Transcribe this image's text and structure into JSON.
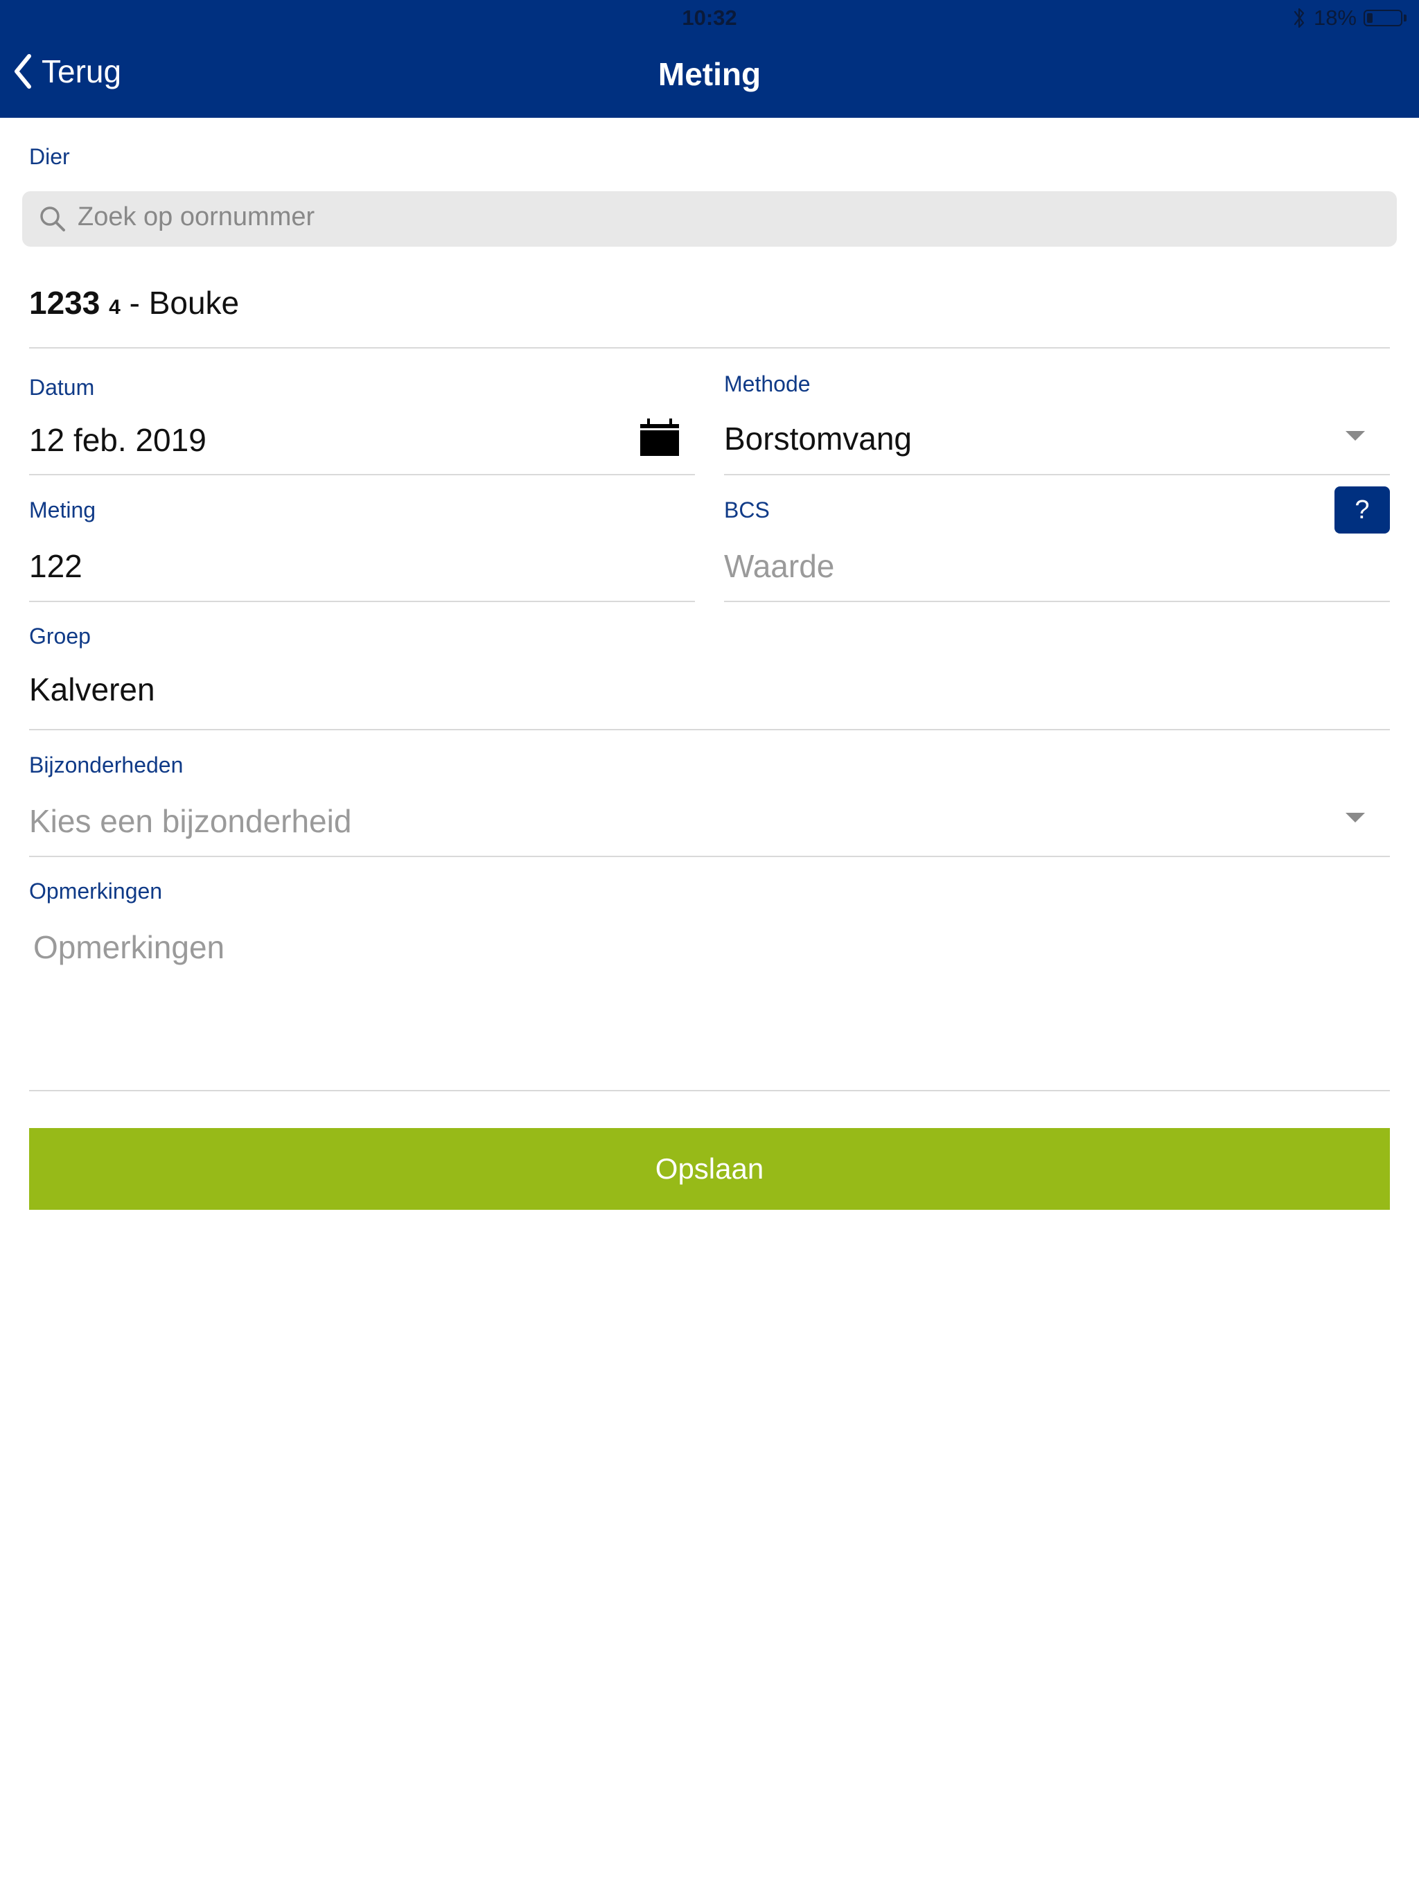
{
  "status_bar": {
    "time": "10:32",
    "battery_percent": "18%",
    "battery_level": 0.18,
    "icons": [
      "bluetooth-icon",
      "battery-icon"
    ]
  },
  "nav": {
    "back_label": "Terug",
    "title": "Meting",
    "back_icon": "chevron-left-icon"
  },
  "colors": {
    "header": "#003080",
    "label": "#0f3a87",
    "save_button": "#97ba18",
    "help_button": "#003080"
  },
  "form": {
    "dier": {
      "label": "Dier",
      "search_placeholder": "Zoek op oornummer",
      "selected_number": "1233",
      "selected_suffix": "4",
      "selected_name": " - Bouke"
    },
    "datum": {
      "label": "Datum",
      "value": "12 feb. 2019"
    },
    "methode": {
      "label": "Methode",
      "value": "Borstomvang"
    },
    "meting": {
      "label": "Meting",
      "value": "122"
    },
    "bcs": {
      "label": "BCS",
      "placeholder": "Waarde",
      "help_label": "?"
    },
    "groep": {
      "label": "Groep",
      "value": "Kalveren"
    },
    "bijzonderheden": {
      "label": "Bijzonderheden",
      "placeholder": "Kies een bijzonderheid"
    },
    "opmerkingen": {
      "label": "Opmerkingen",
      "placeholder": "Opmerkingen"
    }
  },
  "save_label": "Opslaan"
}
